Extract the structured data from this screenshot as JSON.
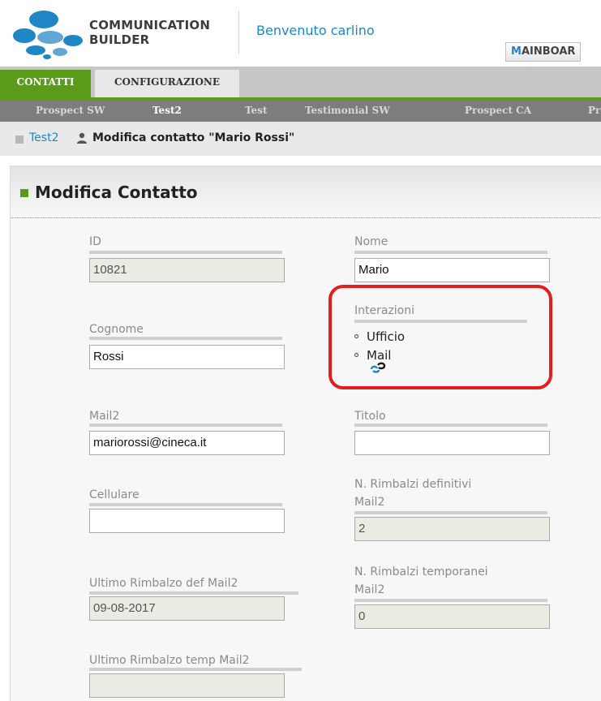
{
  "header": {
    "logo_line1": "COMMUNICATION",
    "logo_line2": "BUILDER",
    "welcome": "Benvenuto carlino",
    "mainboard_prefix": "M",
    "mainboard_rest": "AINBOAR"
  },
  "main_tabs": [
    {
      "label": "CONTATTI",
      "active": true
    },
    {
      "label": "CONFIGURAZIONE",
      "active": false
    }
  ],
  "subnav": [
    {
      "label": "Prospect SW",
      "active": false
    },
    {
      "label": "Test2",
      "active": true
    },
    {
      "label": "Test",
      "active": false
    },
    {
      "label": "Testimonial SW",
      "active": false
    },
    {
      "label": "Prospect CA",
      "active": false
    },
    {
      "label": "Pr",
      "active": false
    }
  ],
  "breadcrumb": {
    "parent": "Test2",
    "current": "Modifica contatto \"Mario Rossi\""
  },
  "panel": {
    "title": "Modifica Contatto"
  },
  "fields": {
    "id": {
      "label": "ID",
      "value": "10821",
      "readonly": true
    },
    "nome": {
      "label": "Nome",
      "value": "Mario"
    },
    "cognome": {
      "label": "Cognome",
      "value": "Rossi"
    },
    "interazioni": {
      "label": "Interazioni",
      "items": [
        "Ufficio",
        "Mail"
      ]
    },
    "mail2": {
      "label": "Mail2",
      "value": "mariorossi@cineca.it"
    },
    "titolo": {
      "label": "Titolo",
      "value": ""
    },
    "cellulare": {
      "label": "Cellulare",
      "value": ""
    },
    "rimbalzi_def": {
      "label_line1": "N. Rimbalzi definitivi",
      "label_line2": "Mail2",
      "value": "2",
      "readonly": true
    },
    "ultimo_def": {
      "label": "Ultimo Rimbalzo def Mail2",
      "value": "09-08-2017",
      "readonly": true
    },
    "rimbalzi_temp": {
      "label_line1": "N. Rimbalzi temporanei",
      "label_line2": "Mail2",
      "value": "0",
      "readonly": true
    },
    "ultimo_temp": {
      "label": "Ultimo Rimbalzo temp Mail2",
      "value": "",
      "readonly": true
    }
  },
  "colors": {
    "accent_green": "#5a9b1a",
    "link_blue": "#1f86c5",
    "highlight_red": "#e0201d"
  },
  "icons": {
    "logo": "communication-builder-logo",
    "breadcrumb_user": "user-icon",
    "interazioni_link": "link-icon"
  }
}
